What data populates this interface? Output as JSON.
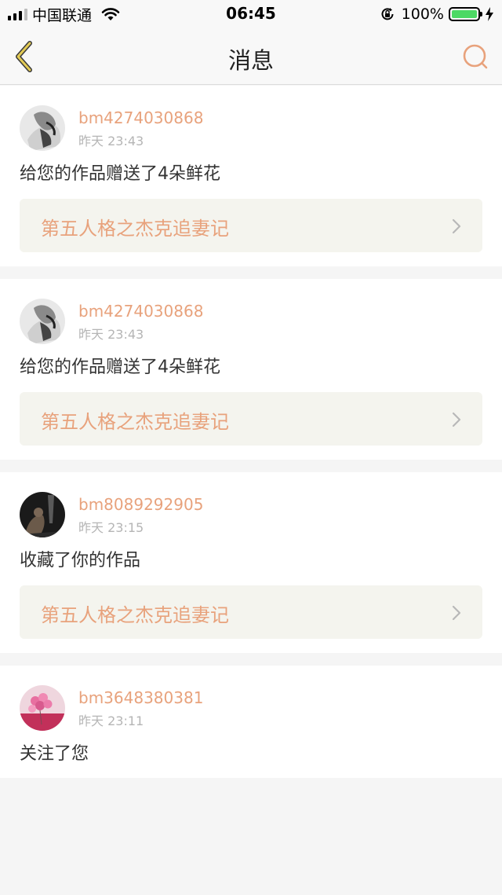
{
  "status_bar": {
    "carrier": "中国联通",
    "time": "06:45",
    "battery": "100%"
  },
  "nav": {
    "title": "消息"
  },
  "colors": {
    "accent": "#e8a27c",
    "back_icon": "#c8a43a"
  },
  "messages": [
    {
      "username": "bm4274030868",
      "time": "昨天 23:43",
      "text": "给您的作品赠送了4朵鲜花",
      "work_title": "第五人格之杰克追妻记",
      "avatar": "avatar-grayscale-portrait"
    },
    {
      "username": "bm4274030868",
      "time": "昨天 23:43",
      "text": "给您的作品赠送了4朵鲜花",
      "work_title": "第五人格之杰克追妻记",
      "avatar": "avatar-grayscale-portrait"
    },
    {
      "username": "bm8089292905",
      "time": "昨天 23:15",
      "text": "收藏了你的作品",
      "work_title": "第五人格之杰克追妻记",
      "avatar": "avatar-dark-figure"
    },
    {
      "username": "bm3648380381",
      "time": "昨天 23:11",
      "text": "关注了您",
      "avatar": "avatar-pink-balloons"
    }
  ]
}
